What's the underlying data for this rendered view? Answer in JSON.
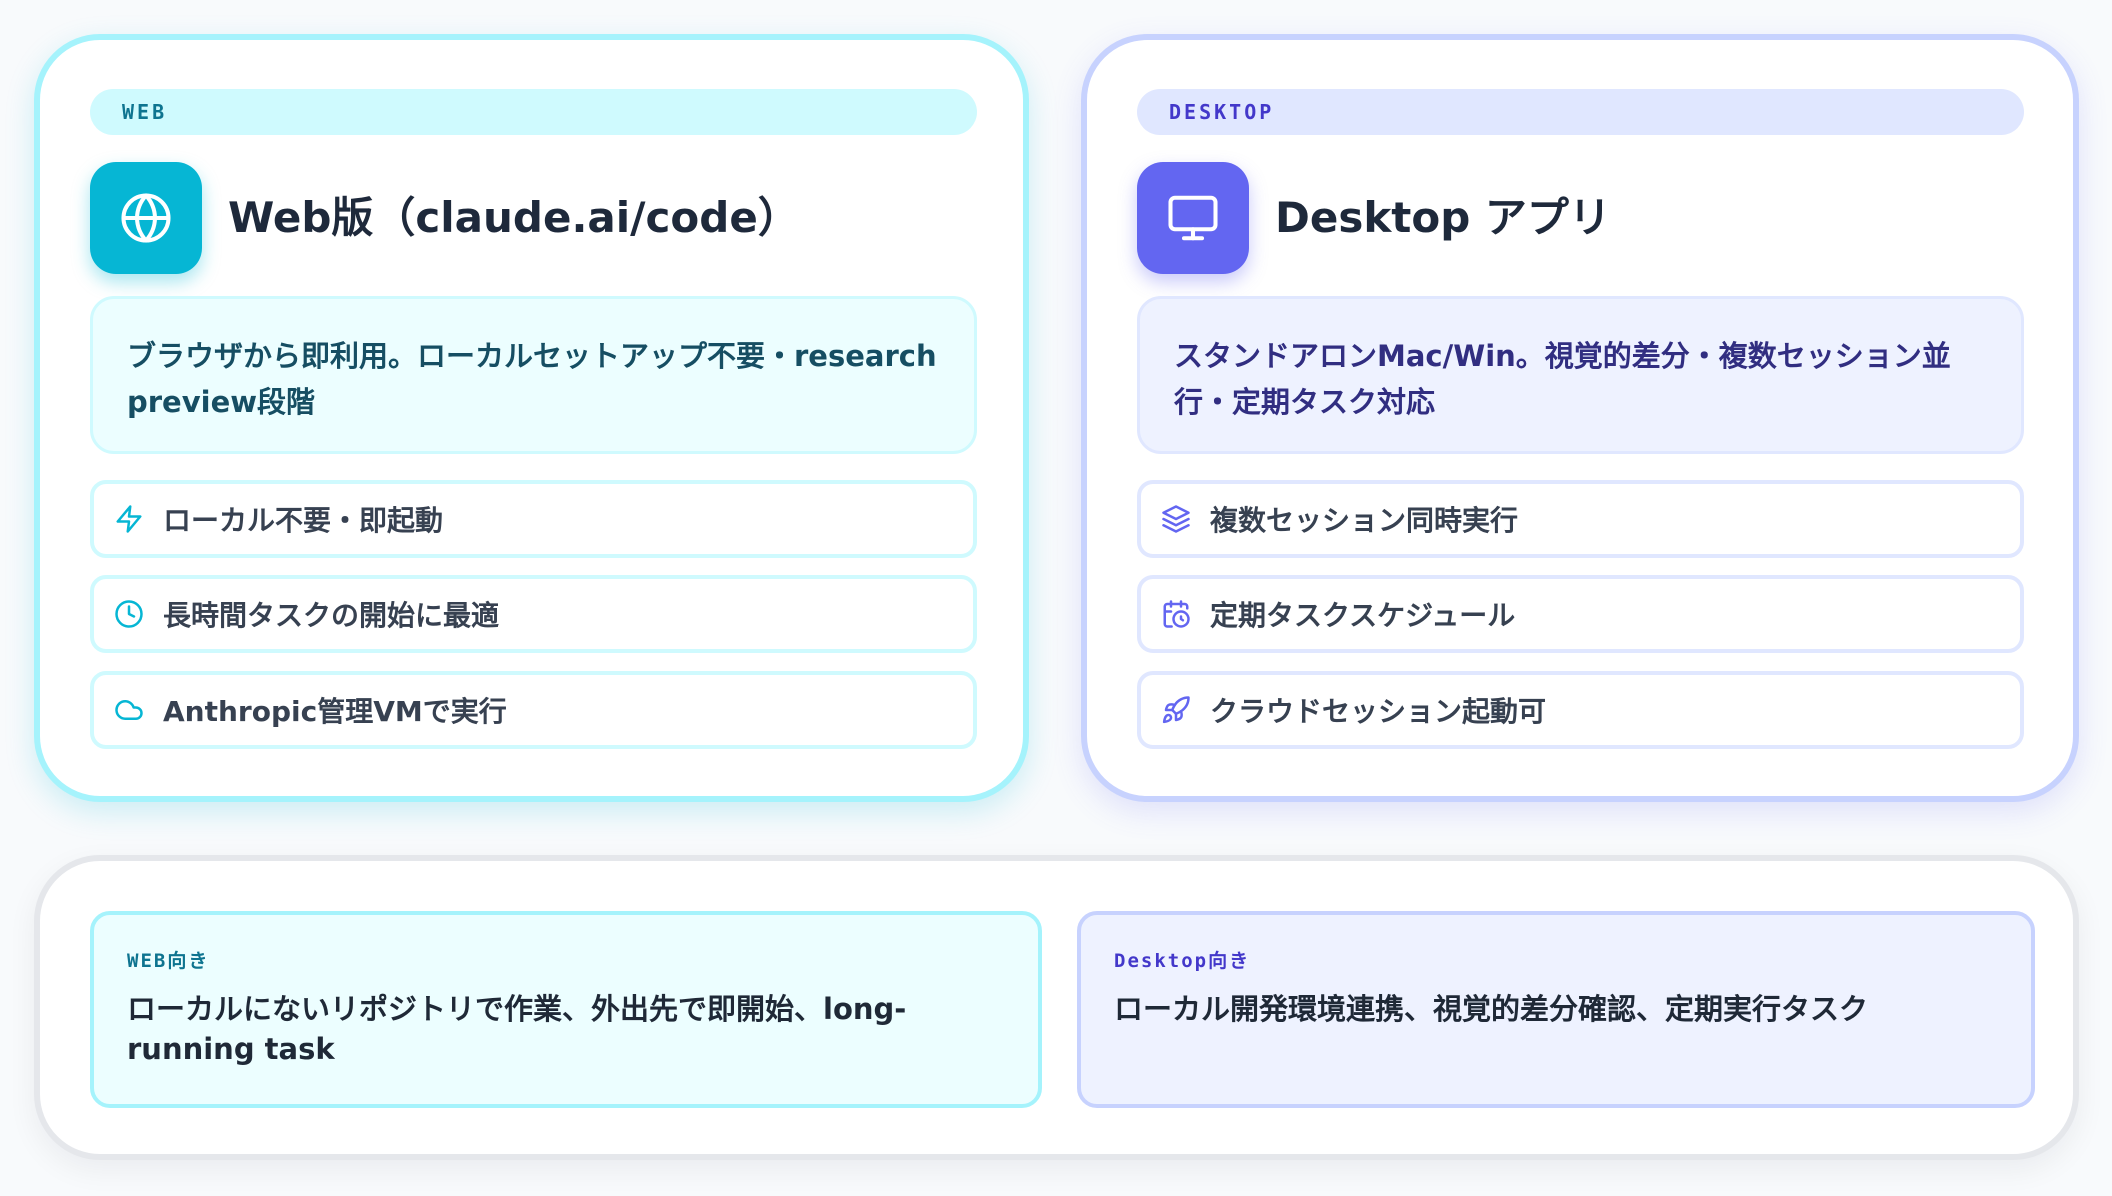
{
  "web": {
    "tag": "WEB",
    "title": "Web版（claude.ai/code）",
    "description": "ブラウザから即利用。ローカルセットアップ不要・research preview段階",
    "features": [
      {
        "icon": "lightning-icon",
        "label": "ローカル不要・即起動"
      },
      {
        "icon": "clock-icon",
        "label": "長時間タスクの開始に最適"
      },
      {
        "icon": "cloud-icon",
        "label": "Anthropic管理VMで実行"
      }
    ]
  },
  "desktop": {
    "tag": "DESKTOP",
    "title": "Desktop アプリ",
    "description": "スタンドアロンMac/Win。視覚的差分・複数セッション並行・定期タスク対応",
    "features": [
      {
        "icon": "layers-icon",
        "label": "複数セッション同時実行"
      },
      {
        "icon": "calendar-clock-icon",
        "label": "定期タスクスケジュール"
      },
      {
        "icon": "rocket-icon",
        "label": "クラウドセッション起動可"
      }
    ]
  },
  "recommendations": {
    "web": {
      "label": "WEB向き",
      "text": "ローカルにないリポジトリで作業、外出先で即開始、long-running task"
    },
    "desktop": {
      "label": "Desktop向き",
      "text": "ローカル開発環境連携、視覚的差分確認、定期実行タスク"
    }
  },
  "colors": {
    "web_accent": "#06b6d4",
    "desktop_accent": "#6366f1"
  }
}
